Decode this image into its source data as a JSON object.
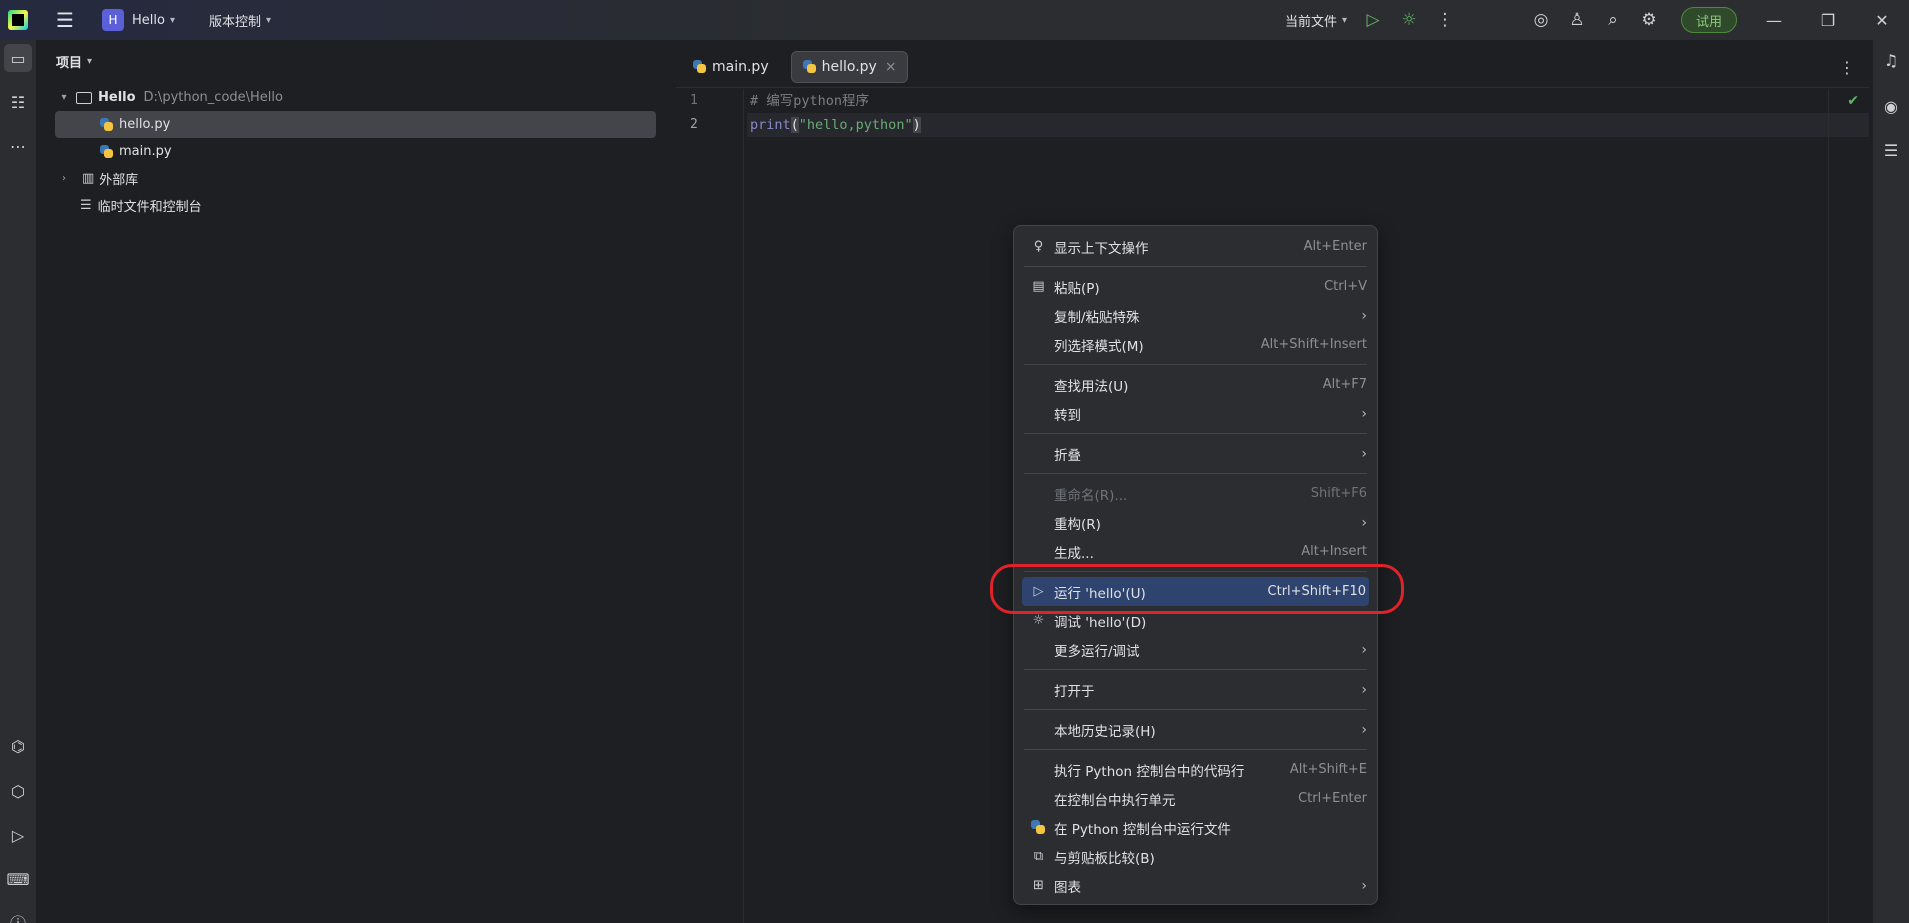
{
  "titlebar": {
    "project_badge": "H",
    "project_name": "Hello",
    "vcs_label": "版本控制",
    "run_config": "当前文件",
    "trial_label": "试用"
  },
  "project_panel": {
    "title": "项目",
    "root_name": "Hello",
    "root_path": "D:\\python_code\\Hello",
    "files": [
      "hello.py",
      "main.py"
    ],
    "external_libs": "外部库",
    "scratches": "临时文件和控制台"
  },
  "editor": {
    "tabs": [
      {
        "label": "main.py",
        "active": false
      },
      {
        "label": "hello.py",
        "active": true
      }
    ],
    "line_numbers": [
      "1",
      "2"
    ],
    "code": {
      "comment": "# 编写python程序",
      "fn": "print",
      "open_paren": "(",
      "string": "\"hello,python\"",
      "close_paren": ")"
    }
  },
  "context_menu": {
    "items": [
      {
        "label": "显示上下文操作",
        "shortcut": "Alt+Enter",
        "icon": "bulb-icon"
      },
      {
        "label": "粘贴(P)",
        "shortcut": "Ctrl+V",
        "icon": "clipboard-icon"
      },
      {
        "label": "复制/粘贴特殊",
        "submenu": true
      },
      {
        "label": "列选择模式(M)",
        "shortcut": "Alt+Shift+Insert"
      },
      {
        "label": "查找用法(U)",
        "shortcut": "Alt+F7"
      },
      {
        "label": "转到",
        "submenu": true
      },
      {
        "label": "折叠",
        "submenu": true
      },
      {
        "label": "重命名(R)...",
        "shortcut": "Shift+F6",
        "disabled": true
      },
      {
        "label": "重构(R)",
        "submenu": true
      },
      {
        "label": "生成...",
        "shortcut": "Alt+Insert"
      },
      {
        "label": "运行 'hello'(U)",
        "shortcut": "Ctrl+Shift+F10",
        "icon": "run-icon",
        "highlighted": true
      },
      {
        "label": "调试 'hello'(D)",
        "icon": "debug-icon"
      },
      {
        "label": "更多运行/调试",
        "submenu": true
      },
      {
        "label": "打开于",
        "submenu": true
      },
      {
        "label": "本地历史记录(H)",
        "submenu": true
      },
      {
        "label": "执行 Python 控制台中的代码行",
        "shortcut": "Alt+Shift+E"
      },
      {
        "label": "在控制台中执行单元",
        "shortcut": "Ctrl+Enter"
      },
      {
        "label": "在 Python 控制台中运行文件",
        "icon": "python-icon"
      },
      {
        "label": "与剪贴板比较(B)",
        "icon": "compare-icon"
      },
      {
        "label": "图表",
        "submenu": true,
        "icon": "diagram-icon"
      }
    ]
  },
  "colors": {
    "accent_highlight": "#2e436e",
    "annotation": "#e0232b",
    "run_green": "#5fb865"
  }
}
